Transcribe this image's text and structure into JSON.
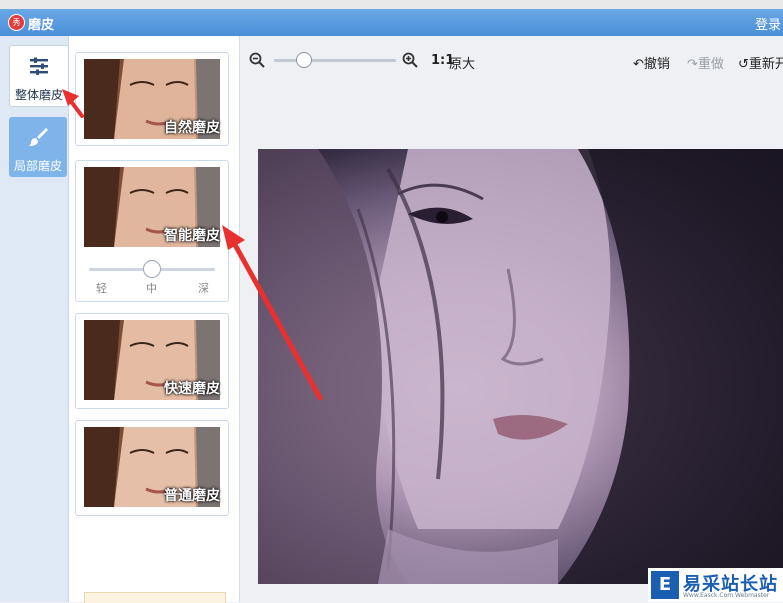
{
  "window": {
    "logo_text": "秀",
    "title": "磨皮",
    "login": "登录"
  },
  "leftnav": {
    "items": [
      {
        "label": "整体磨皮",
        "icon": "sliders-icon",
        "selected": true
      },
      {
        "label": "局部磨皮",
        "icon": "brush-icon",
        "selected": false
      }
    ]
  },
  "presets": {
    "cards": [
      {
        "label": "自然磨皮"
      },
      {
        "label": "智能磨皮"
      },
      {
        "label": "快速磨皮"
      },
      {
        "label": "普通磨皮"
      }
    ],
    "strength": {
      "ticks": [
        "轻",
        "中",
        "深"
      ],
      "selected": "中",
      "level": 0.5
    }
  },
  "toolbar": {
    "zoom_level": 0.2,
    "ratio_label": "1:1",
    "original_label": "原大",
    "undo_label": "撤销",
    "redo_label": "重做",
    "reset_label": "重新开"
  },
  "watermark": {
    "logo_text": "E",
    "title": "易采站长站",
    "subtitle": "Www.Easck.Com Webmaster"
  },
  "colors": {
    "titlebar": "#4a8fd8",
    "accent": "#7fb4ea",
    "annotation_arrow": "#e8312f"
  }
}
